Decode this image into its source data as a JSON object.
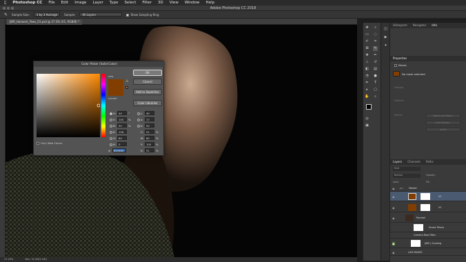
{
  "menubar": {
    "apple": "",
    "app": "Photoshop CC",
    "items": [
      "File",
      "Edit",
      "Image",
      "Layer",
      "Type",
      "Select",
      "Filter",
      "3D",
      "View",
      "Window",
      "Help"
    ]
  },
  "window": {
    "title": "Adobe Photoshop CC 2018"
  },
  "options_bar": {
    "sample_size_label": "Sample Size:",
    "sample_size_value": "3 by 3 Average",
    "sample_label": "Sample:",
    "sample_value": "All Layers",
    "show_ring": "Show Sampling Ring"
  },
  "document": {
    "tab": "JWR_Harwerk_Tews_01.psd @ 27.3% (V1, RGB/8) *",
    "zoom": "27.29%",
    "doc_size": "Doc: 31.2M/1.04G"
  },
  "color_picker": {
    "title": "Color Picker (Solid Color)",
    "ok": "OK",
    "cancel": "Cancel",
    "add_swatches": "Add to Swatches",
    "color_libraries": "Color Libraries",
    "new_label": "new",
    "current_label": "current",
    "only_web": "Only Web Colors",
    "new_color": "#823e00",
    "current_color": "#823e00",
    "hue_color": "#ff8800",
    "fields": {
      "H": "44",
      "S": "100",
      "B": "50",
      "R": "128",
      "G": "84",
      "Bb": "0",
      "L": "40",
      "a": "17",
      "b": "50",
      "C": "51",
      "M": "60",
      "Y": "100",
      "K": "51",
      "hex": "825400"
    },
    "units": {
      "deg": "°",
      "pct": "%"
    }
  },
  "right_panels": {
    "top_tabs": [
      "Histogram",
      "Navigator",
      "Info"
    ],
    "properties_tab": "Properties",
    "masks_label": "Masks",
    "no_mask": "No mask selected",
    "density": "Density:",
    "feather": "Feather:",
    "refine": "Refine:",
    "select_mask": "Select and Mask...",
    "color_range": "Color Range...",
    "invert": "Invert",
    "layers_tabs": [
      "Layers",
      "Channels",
      "Paths"
    ],
    "kind": "Kind",
    "normal": "Normal",
    "opacity": "Opacity:",
    "fill": "Fill:",
    "lock": "Lock:",
    "layers": [
      {
        "name": "Master"
      },
      {
        "name": "V1"
      },
      {
        "name": "V1"
      },
      {
        "name": "Portrait"
      },
      {
        "name": "Smart Filters"
      },
      {
        "name": "Camera Raw Filter"
      },
      {
        "name": "JWR | Grading"
      },
      {
        "name": "LUM MASKS"
      }
    ]
  }
}
